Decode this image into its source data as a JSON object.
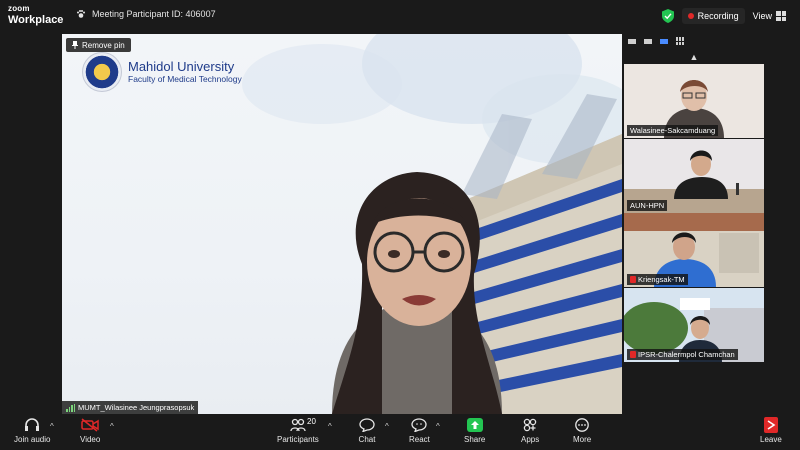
{
  "brand": {
    "line1": "zoom",
    "line2": "Workplace"
  },
  "meeting": {
    "label": "Meeting Participant ID: 406007"
  },
  "topbar": {
    "recording": "Recording",
    "view": "View"
  },
  "pin": {
    "label": "Remove pin"
  },
  "main_video": {
    "university": "Mahidol University",
    "faculty": "Faculty of Medical Technology",
    "participant": "MUMT_Wilasinee Jeungprasopsuk"
  },
  "gallery": {
    "tiles": [
      {
        "name": "Walasinee-Sakcamduang"
      },
      {
        "name": "AUN-HPN"
      },
      {
        "name": "Kriengsak-TM"
      },
      {
        "name": "IPSR-Chalermpol Chamchan"
      }
    ]
  },
  "toolbar": {
    "join_audio": "Join audio",
    "video": "Video",
    "participants": "Participants",
    "participants_count": "20",
    "chat": "Chat",
    "react": "React",
    "share": "Share",
    "apps": "Apps",
    "more": "More",
    "leave": "Leave"
  },
  "colors": {
    "share_green": "#23c552",
    "recording_red": "#e02828",
    "leave_red": "#e02828",
    "brand_blue": "#1f3b8a"
  }
}
